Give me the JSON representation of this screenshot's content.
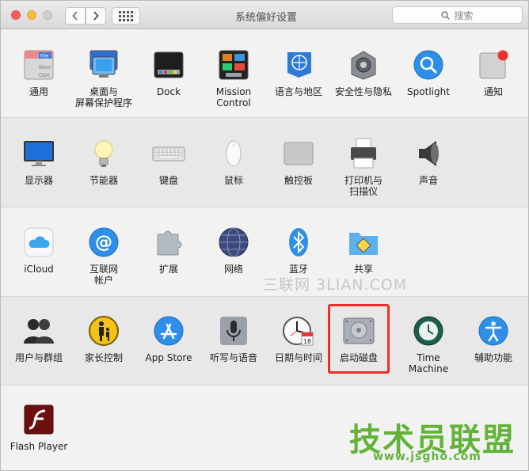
{
  "window": {
    "title": "系统偏好设置",
    "search_placeholder": "搜索"
  },
  "rows": [
    [
      {
        "id": "general",
        "label": "通用",
        "icon": "general-icon"
      },
      {
        "id": "desktop",
        "label": "桌面与\n屏幕保护程序",
        "icon": "desktop-screensaver-icon"
      },
      {
        "id": "dock",
        "label": "Dock",
        "icon": "dock-icon"
      },
      {
        "id": "mission",
        "label": "Mission\nControl",
        "icon": "mission-control-icon"
      },
      {
        "id": "language",
        "label": "语言与地区",
        "icon": "language-region-icon"
      },
      {
        "id": "security",
        "label": "安全性与隐私",
        "icon": "security-privacy-icon"
      },
      {
        "id": "spotlight",
        "label": "Spotlight",
        "icon": "spotlight-icon"
      },
      {
        "id": "notifications",
        "label": "通知",
        "icon": "notifications-icon"
      }
    ],
    [
      {
        "id": "displays",
        "label": "显示器",
        "icon": "displays-icon"
      },
      {
        "id": "energy",
        "label": "节能器",
        "icon": "energy-saver-icon"
      },
      {
        "id": "keyboard",
        "label": "键盘",
        "icon": "keyboard-icon"
      },
      {
        "id": "mouse",
        "label": "鼠标",
        "icon": "mouse-icon"
      },
      {
        "id": "trackpad",
        "label": "触控板",
        "icon": "trackpad-icon"
      },
      {
        "id": "printers",
        "label": "打印机与\n扫描仪",
        "icon": "printer-scanner-icon"
      },
      {
        "id": "sound",
        "label": "声音",
        "icon": "sound-icon"
      }
    ],
    [
      {
        "id": "icloud",
        "label": "iCloud",
        "icon": "icloud-icon"
      },
      {
        "id": "internet",
        "label": "互联网\n帐户",
        "icon": "internet-accounts-icon"
      },
      {
        "id": "extensions",
        "label": "扩展",
        "icon": "extensions-icon"
      },
      {
        "id": "network",
        "label": "网络",
        "icon": "network-icon"
      },
      {
        "id": "bluetooth",
        "label": "蓝牙",
        "icon": "bluetooth-icon"
      },
      {
        "id": "sharing",
        "label": "共享",
        "icon": "sharing-icon"
      }
    ],
    [
      {
        "id": "users",
        "label": "用户与群组",
        "icon": "users-groups-icon"
      },
      {
        "id": "parental",
        "label": "家长控制",
        "icon": "parental-controls-icon"
      },
      {
        "id": "appstore",
        "label": "App Store",
        "icon": "app-store-icon"
      },
      {
        "id": "dictation",
        "label": "听写与语音",
        "icon": "dictation-speech-icon"
      },
      {
        "id": "datetime",
        "label": "日期与时间",
        "icon": "date-time-icon"
      },
      {
        "id": "startup",
        "label": "启动磁盘",
        "icon": "startup-disk-icon"
      },
      {
        "id": "timemachine",
        "label": "Time Machine",
        "icon": "time-machine-icon"
      },
      {
        "id": "accessibility",
        "label": "辅助功能",
        "icon": "accessibility-icon"
      }
    ],
    [
      {
        "id": "flash",
        "label": "Flash Player",
        "icon": "flash-player-icon"
      }
    ]
  ],
  "watermarks": {
    "top": "三联网 3LIAN.COM",
    "brand": "技术员联盟",
    "url": "www.jsgho.com"
  },
  "colors": {
    "highlight": "#e8312f",
    "watermark_green": "#63b33a"
  }
}
